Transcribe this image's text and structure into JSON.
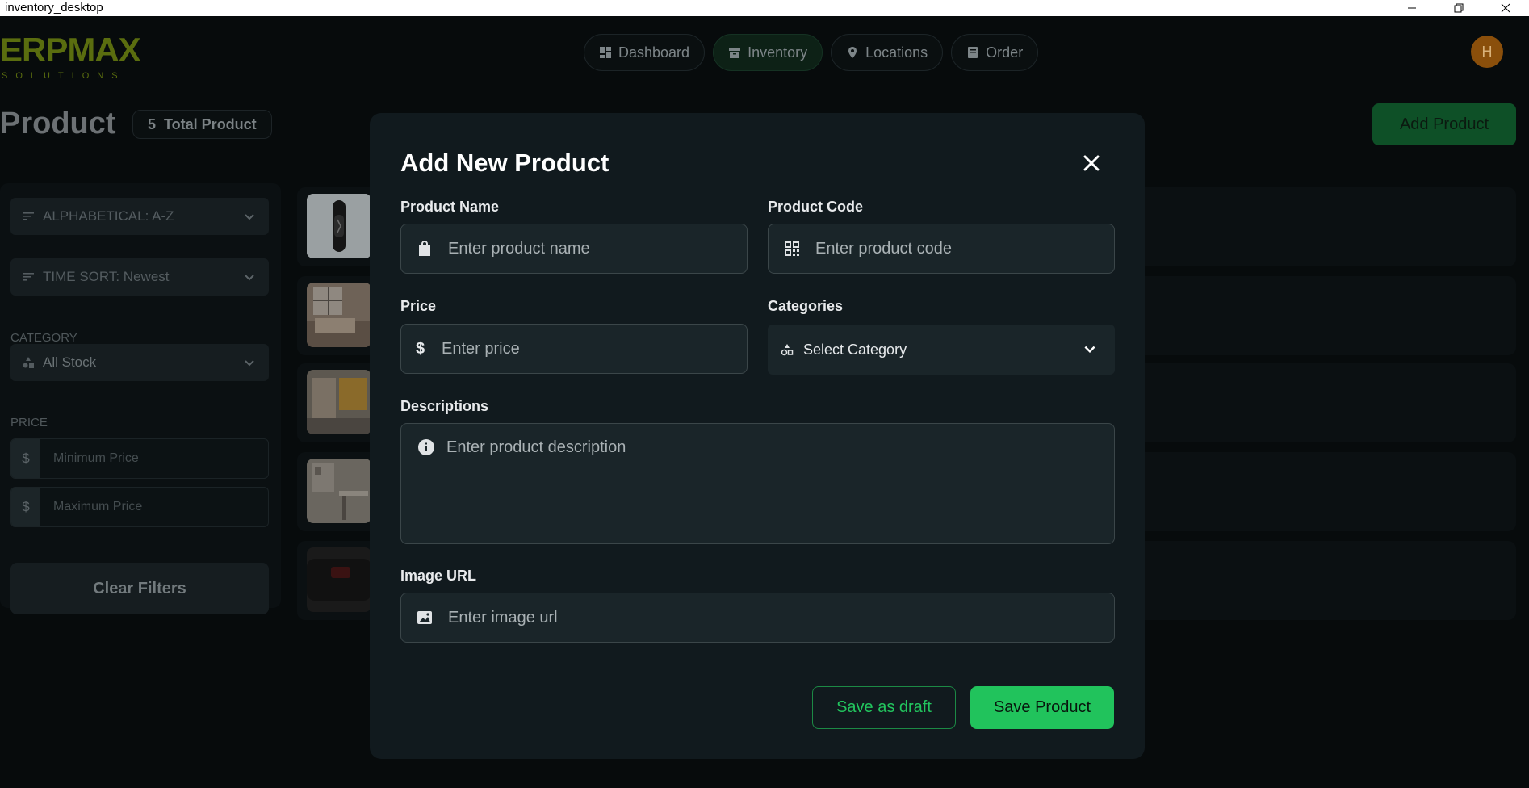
{
  "window": {
    "title": "inventory_desktop"
  },
  "header": {
    "logo_text": "ERPMAX",
    "logo_sub": "SOLUTIONS",
    "nav": [
      {
        "label": "Dashboard",
        "icon": "dashboard-icon"
      },
      {
        "label": "Inventory",
        "icon": "archive-icon",
        "active": true
      },
      {
        "label": "Locations",
        "icon": "location-pin-icon"
      },
      {
        "label": "Order",
        "icon": "order-icon"
      }
    ],
    "avatar_initial": "H"
  },
  "page": {
    "title": "Product",
    "count": "5",
    "count_label": "Total Product",
    "add_button": "Add Product"
  },
  "sidebar": {
    "sort_alpha": "ALPHABETICAL: A-Z",
    "sort_time": "TIME SORT: Newest",
    "category_label": "CATEGORY",
    "category_value": "All Stock",
    "price_label": "PRICE",
    "currency": "$",
    "min_placeholder": "Minimum Price",
    "max_placeholder": "Maximum Price",
    "clear_button": "Clear Filters"
  },
  "products": [
    {
      "thumb": "watch"
    },
    {
      "thumb": "bedroom"
    },
    {
      "thumb": "furniture"
    },
    {
      "thumb": "desk"
    },
    {
      "thumb": "speaker"
    }
  ],
  "modal": {
    "title": "Add New Product",
    "product_name_label": "Product Name",
    "product_name_placeholder": "Enter product name",
    "product_code_label": "Product Code",
    "product_code_placeholder": "Enter product code",
    "price_label": "Price",
    "price_currency": "$",
    "price_placeholder": "Enter price",
    "categories_label": "Categories",
    "categories_value": "Select Category",
    "descriptions_label": "Descriptions",
    "descriptions_placeholder": "Enter product description",
    "image_url_label": "Image URL",
    "image_url_placeholder": "Enter image url",
    "draft_button": "Save as draft",
    "save_button": "Save Product"
  },
  "colors": {
    "accent": "#21c35c",
    "modal_bg": "#111a1e",
    "avatar": "#8a4f0b"
  }
}
